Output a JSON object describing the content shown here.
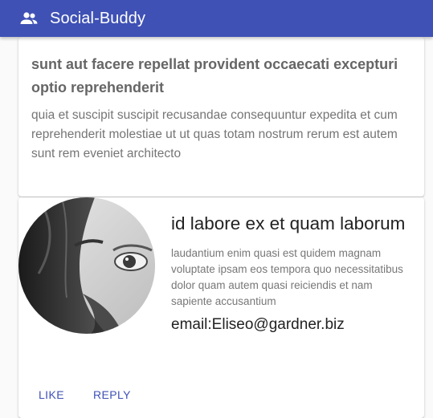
{
  "appbar": {
    "icon": "group-icon",
    "title": "Social-Buddy"
  },
  "post": {
    "title": "sunt aut facere repellat provident occaecati excepturi optio reprehenderit",
    "body": "quia et suscipit suscipit recusandae consequuntur expedita et cum reprehenderit molestiae ut ut quas totam nostrum rerum est autem sunt rem eveniet architecto"
  },
  "user": {
    "avatar_icon": "avatar-photo",
    "name": "id labore ex et quam laborum",
    "description": "laudantium enim quasi est quidem magnam voluptate ipsam eos tempora quo necessitatibus dolor quam autem quasi reiciendis et nam sapiente accusantium",
    "email": "email:Eliseo@gardner.biz",
    "actions": {
      "like": "LIKE",
      "reply": "REPLY"
    }
  },
  "colors": {
    "primary": "#3f51b5",
    "background": "#fafafa"
  }
}
